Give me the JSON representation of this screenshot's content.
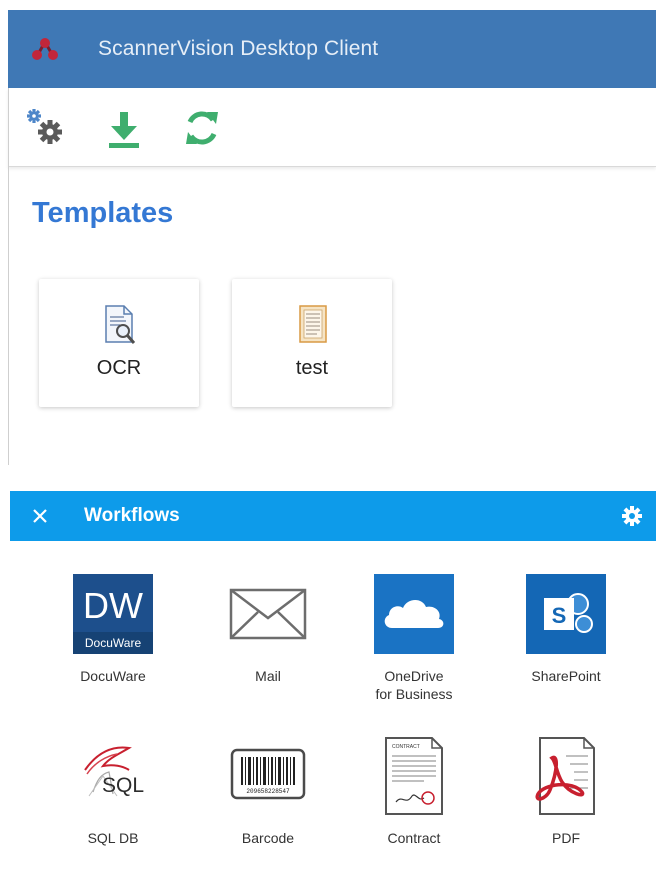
{
  "app": {
    "title": "ScannerVision Desktop Client",
    "title_bar_color": "#3f78b5"
  },
  "toolbar": {
    "buttons": [
      {
        "name": "settings",
        "icon": "gears-icon"
      },
      {
        "name": "download",
        "icon": "download-icon"
      },
      {
        "name": "refresh",
        "icon": "refresh-icon"
      }
    ]
  },
  "templates": {
    "heading": "Templates",
    "items": [
      {
        "label": "OCR",
        "icon": "ocr-document-icon"
      },
      {
        "label": "test",
        "icon": "form-document-icon"
      }
    ]
  },
  "workflows": {
    "title": "Workflows",
    "header_color": "#0d9bea",
    "close_glyph": "✕",
    "items": [
      {
        "label": "DocuWare",
        "icon": "docuware-icon",
        "logo_letters": "DW",
        "logo_wordmark": "DocuWare"
      },
      {
        "label": "Mail",
        "icon": "mail-envelope-icon"
      },
      {
        "label": "OneDrive\nfor Business",
        "icon": "onedrive-cloud-icon"
      },
      {
        "label": "SharePoint",
        "icon": "sharepoint-icon",
        "logo_letter": "S"
      },
      {
        "label": "SQL DB",
        "icon": "sql-database-icon",
        "logo_text": "SQL"
      },
      {
        "label": "Barcode",
        "icon": "barcode-icon",
        "barcode_digits": "209658228547"
      },
      {
        "label": "Contract",
        "icon": "contract-document-icon",
        "doc_heading": "CONTRACT"
      },
      {
        "label": "PDF",
        "icon": "pdf-document-icon"
      }
    ]
  }
}
